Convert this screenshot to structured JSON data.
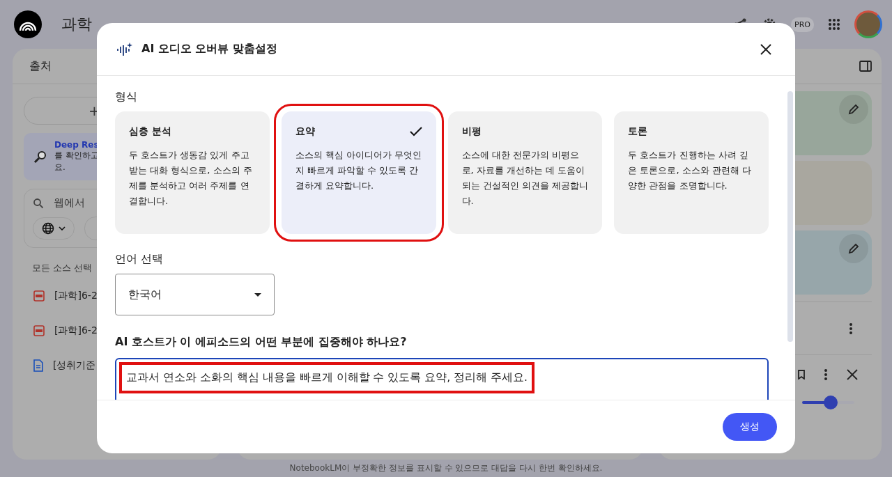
{
  "app": {
    "title": "과학",
    "pro_badge": "PRO"
  },
  "sources_panel": {
    "title": "출처",
    "add_button": "+",
    "deep_research": {
      "link": "Deep Res",
      "lines": [
        "를 확인하고",
        "요."
      ]
    },
    "search": {
      "placeholder": "웹에서"
    },
    "select_all": "모든 소스 선택",
    "sources": [
      {
        "kind": "pdf",
        "name": "[과학]6-2"
      },
      {
        "kind": "pdf",
        "name": "[과학]6-2"
      },
      {
        "kind": "doc",
        "name": "[성취기준"
      }
    ]
  },
  "studio_panel": {
    "cards": [
      {
        "color": "#98a69b",
        "editable": true
      },
      {
        "color": "#a9a79f",
        "editable": false
      },
      {
        "color": "#97a6aa",
        "editable": true
      }
    ],
    "player": {
      "level": 0.55
    }
  },
  "footer_note": "NotebookLM이 부정확한 정보를 표시할 수 있으므로 대답을 다시 한번 확인하세요.",
  "dialog": {
    "title": "AI 오디오 오버뷰 맞춤설정",
    "format_label": "형식",
    "formats": [
      {
        "title": "심층 분석",
        "description": "두 호스트가 생동감 있게 주고받는 대화 형식으로, 소스의 주제를 분석하고 여러 주제를 연결합니다.",
        "selected": false
      },
      {
        "title": "요약",
        "description": "소스의 핵심 아이디어가 무엇인지 빠르게 파악할 수 있도록 간결하게 요약합니다.",
        "selected": true
      },
      {
        "title": "비평",
        "description": "소스에 대한 전문가의 비평으로, 자료를 개선하는 데 도움이 되는 건설적인 의견을 제공합니다.",
        "selected": false
      },
      {
        "title": "토론",
        "description": "두 호스트가 진행하는 사려 깊은 토론으로, 소스와 관련해 다양한 관점을 조명합니다.",
        "selected": false
      }
    ],
    "language_label": "언어 선택",
    "language": "한국어",
    "focus_label": "AI 호스트가 이 에피소드의 어떤 부분에 집중해야 하나요?",
    "focus_value": "교과서 연소와 소화의 핵심 내용을 빠르게 이해할 수 있도록 요약, 정리해 주세요.",
    "generate_button": "생성"
  }
}
